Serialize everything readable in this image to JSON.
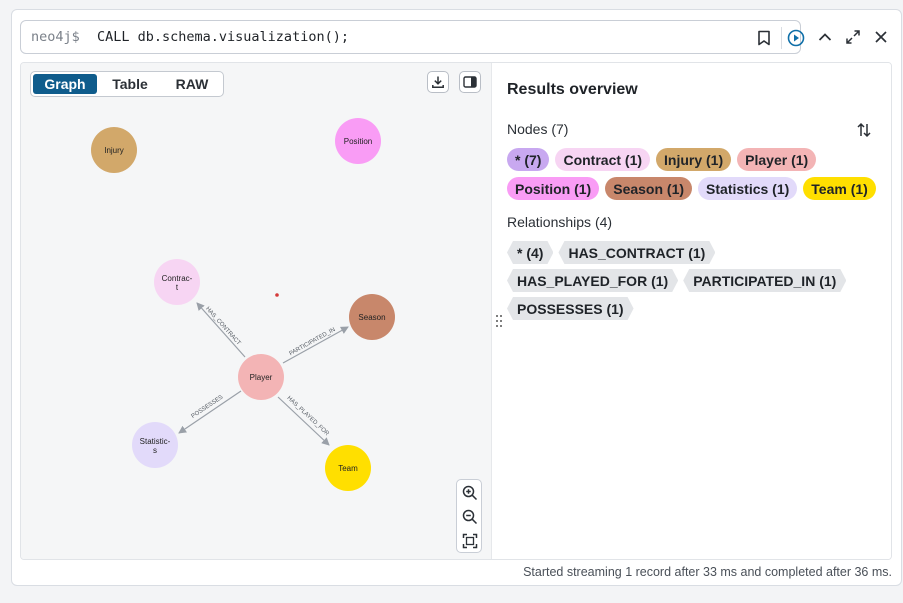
{
  "editor": {
    "prompt": "neo4j$",
    "query": "CALL db.schema.visualization();"
  },
  "tabs": [
    "Graph",
    "Table",
    "RAW"
  ],
  "active_tab": "Graph",
  "graph": {
    "nodes": [
      {
        "label": "Injury",
        "color": "#d2a86a"
      },
      {
        "label": "Position",
        "color": "#f99cf5"
      },
      {
        "label": "Contract",
        "color": "#f7d5f3"
      },
      {
        "label": "Season",
        "color": "#c8876b"
      },
      {
        "label": "Player",
        "color": "#f3b4b5"
      },
      {
        "label": "Statistics",
        "color": "#e2dafa"
      },
      {
        "label": "Team",
        "color": "#ffdf00"
      }
    ],
    "relationships": [
      {
        "type": "HAS_CONTRACT",
        "from": "Player",
        "to": "Contract"
      },
      {
        "type": "PARTICIPATED_IN",
        "from": "Player",
        "to": "Season"
      },
      {
        "type": "POSSESSES",
        "from": "Player",
        "to": "Statistics"
      },
      {
        "type": "HAS_PLAYED_FOR",
        "from": "Player",
        "to": "Team"
      }
    ]
  },
  "overview": {
    "title": "Results overview",
    "nodes_label": "Nodes (7)",
    "node_chips": [
      {
        "label": "* (7)",
        "color": "#c8a8f0"
      },
      {
        "label": "Contract (1)",
        "color": "#f7d5f3"
      },
      {
        "label": "Injury (1)",
        "color": "#d2a86a"
      },
      {
        "label": "Player (1)",
        "color": "#f3b4b5"
      },
      {
        "label": "Position (1)",
        "color": "#f99cf5"
      },
      {
        "label": "Season (1)",
        "color": "#c8876b"
      },
      {
        "label": "Statistics (1)",
        "color": "#e2dafa"
      },
      {
        "label": "Team (1)",
        "color": "#ffdf00"
      }
    ],
    "relationships_label": "Relationships (4)",
    "rel_chips": [
      "* (4)",
      "HAS_CONTRACT (1)",
      "HAS_PLAYED_FOR (1)",
      "PARTICIPATED_IN (1)",
      "POSSESSES (1)"
    ]
  },
  "status": "Started streaming 1 record after 33 ms and completed after 36 ms."
}
